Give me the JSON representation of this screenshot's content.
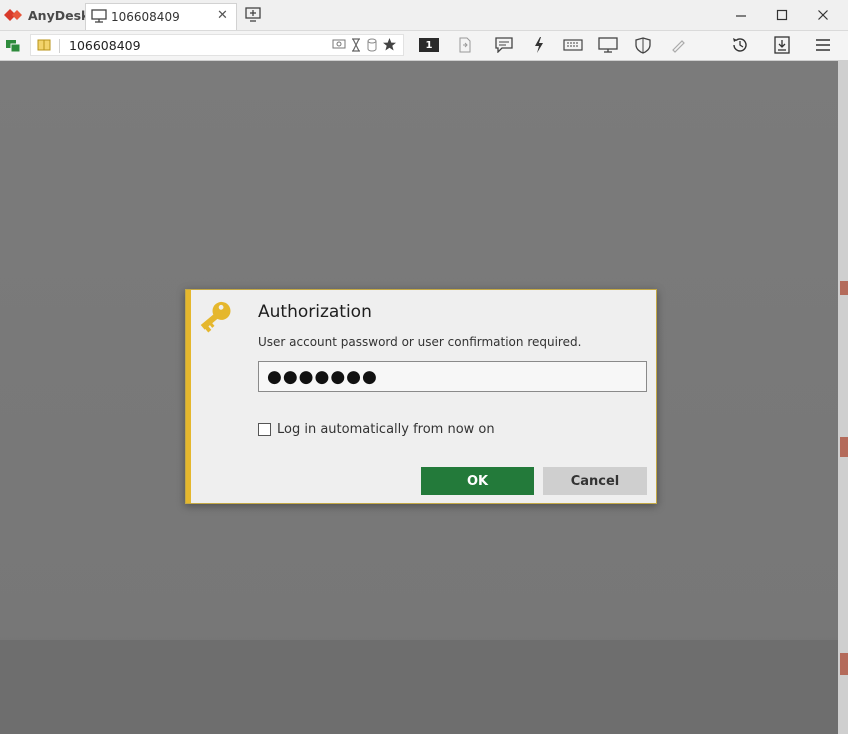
{
  "app": {
    "name": "AnyDesk",
    "brand_color": "#d83a2a"
  },
  "tab": {
    "label": "106608409",
    "close": "✕"
  },
  "window_controls": {
    "minimize": "–",
    "maximize": "☐",
    "close": "✕"
  },
  "toolbar": {
    "address": "106608409",
    "monitor_badge": "1"
  },
  "dialog": {
    "title": "Authorization",
    "subtitle": "User account password or user confirmation required.",
    "password_mask": "●●●●●●●",
    "checkbox_label": "Log in automatically from now on",
    "ok_label": "OK",
    "cancel_label": "Cancel",
    "accent_color": "#e5b72d",
    "ok_color": "#237a3a"
  }
}
